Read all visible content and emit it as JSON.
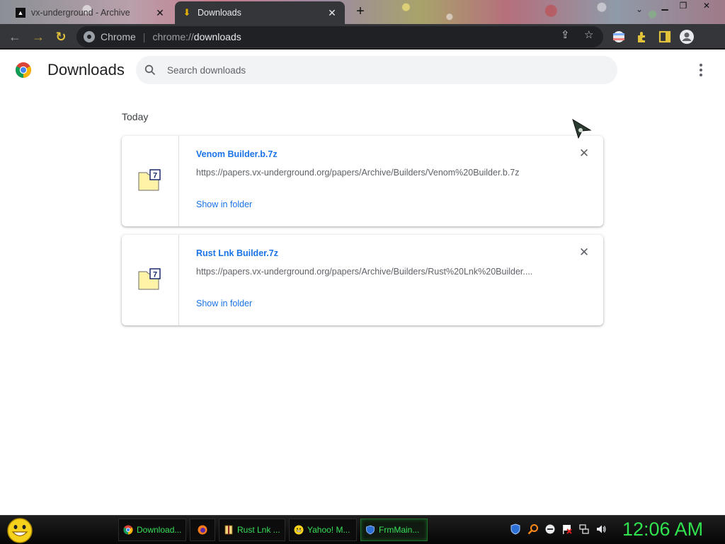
{
  "tabs": [
    {
      "title": "vx-underground - Archive",
      "active": false
    },
    {
      "title": "Downloads",
      "active": true
    }
  ],
  "toolbar": {
    "omnibox_chip": "Chrome",
    "url_scheme": "chrome://",
    "url_host": "downloads"
  },
  "page": {
    "title": "Downloads",
    "search_placeholder": "Search downloads",
    "section_label": "Today"
  },
  "downloads": [
    {
      "filename": "Venom Builder.b.7z",
      "url": "https://papers.vx-underground.org/papers/Archive/Builders/Venom%20Builder.b.7z",
      "action": "Show in folder"
    },
    {
      "filename": "Rust Lnk Builder.7z",
      "url": "https://papers.vx-underground.org/papers/Archive/Builders/Rust%20Lnk%20Builder....",
      "action": "Show in folder"
    }
  ],
  "taskbar": {
    "buttons": [
      {
        "label": "Download...",
        "icon": "chrome-icon"
      },
      {
        "label": "",
        "icon": "firefox-icon"
      },
      {
        "label": "Rust Lnk ...",
        "icon": "archive-icon"
      },
      {
        "label": "Yahoo! M...",
        "icon": "yahoo-messenger-icon"
      },
      {
        "label": "FrmMain...",
        "icon": "shield-icon"
      }
    ],
    "clock": "12:06 AM"
  },
  "colors": {
    "accent": "#1a73e8",
    "toolbar_bg": "#35363a",
    "taskbar_text": "#37e05a"
  }
}
